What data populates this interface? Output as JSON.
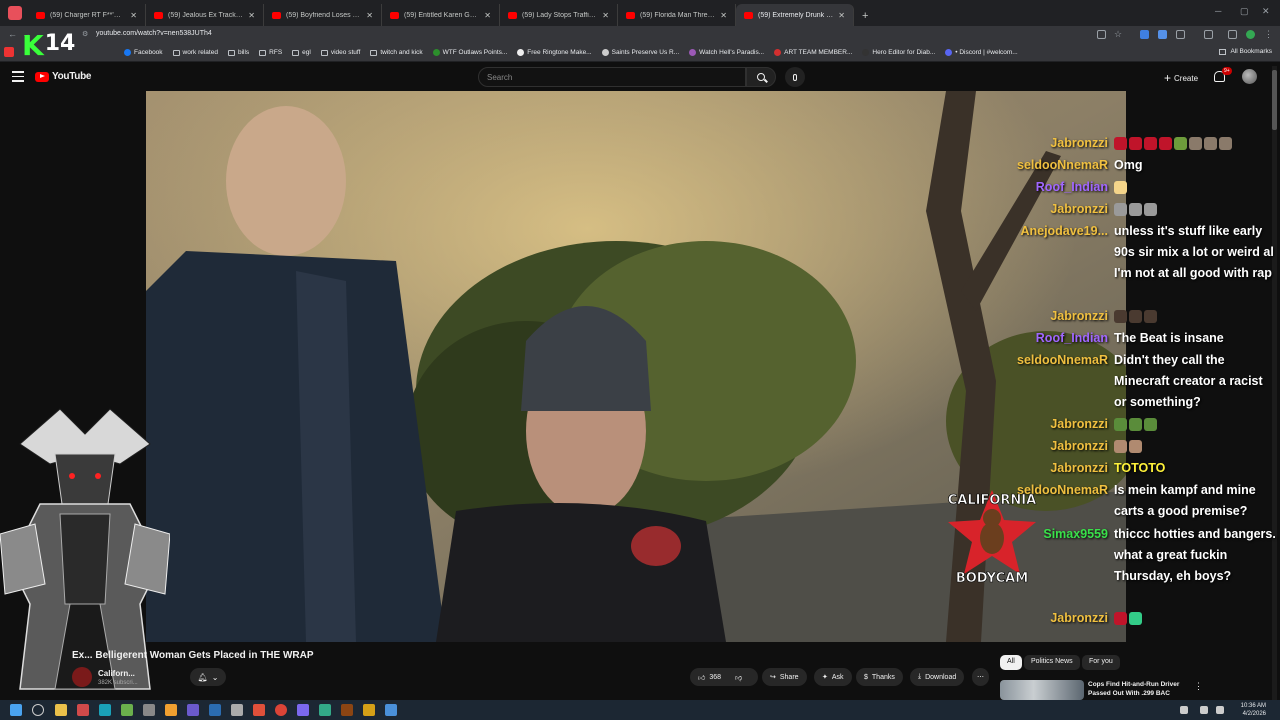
{
  "browser": {
    "tabs": [
      {
        "title": "(59) Charger RT F**'S UP Calif"
      },
      {
        "title": "(59) Jealous Ex Tracks His Loca"
      },
      {
        "title": "(59) Boyfriend Loses It After He"
      },
      {
        "title": "(59) Entitled Karen Goes Ballis"
      },
      {
        "title": "(59) Lady Stops Traffic to Help"
      },
      {
        "title": "(59) Florida Man Threatens Offi"
      },
      {
        "title": "(59) Extremely Drunk and Bellig",
        "active": true
      }
    ],
    "url": "youtube.com/watch?v=nen538JUTh4",
    "bookmarks": [
      "Facebook",
      "work related",
      "bills",
      "RFS",
      "egl",
      "video stuff",
      "twitch and kick",
      "WTF Outlaws Points...",
      "Free Ringtone Make...",
      "Saints Preserve Us R...",
      "Watch Hell's Paradis...",
      "ART TEAM MEMBER...",
      "Hero Editor for Diab...",
      "• Discord | #welcom..."
    ],
    "all_bookmarks": "All Bookmarks",
    "stream_overlay": {
      "k": "K",
      "number": "14"
    }
  },
  "youtube": {
    "logo": "YouTube",
    "search_placeholder": "Search",
    "create_label": "Create",
    "notification_count": "9+"
  },
  "chat": [
    {
      "user": "Jabronzzi",
      "color": "#f0c040",
      "msg": "",
      "emotes": [
        "#c0142a",
        "#c0142a",
        "#c0142a",
        "#c0142a",
        "#6d9c3b",
        "#8a7a6a",
        "#8a7a6a",
        "#8a7a6a"
      ]
    },
    {
      "user": "seldooNnemaR",
      "color": "#f0c040",
      "msg": "Omg",
      "emotes": []
    },
    {
      "user": "Roof_Indian",
      "color": "#a066ff",
      "msg": "",
      "emotes": [
        "#f5d58a"
      ]
    },
    {
      "user": "Jabronzzi",
      "color": "#f0c040",
      "msg": "",
      "emotes": [
        "#9a9a9a",
        "#9a9a9a",
        "#9a9a9a"
      ]
    },
    {
      "user": "Anejodave19...",
      "color": "#f0c040",
      "msg": "unless it's stuff like early 90s sir mix a lot or weird al I'm not at all good with rap",
      "lines": 4,
      "emotes": []
    },
    {
      "user": "Jabronzzi",
      "color": "#f0c040",
      "msg": "",
      "emotes": [
        "#4a3a30",
        "#4a3a30",
        "#4a3a30"
      ]
    },
    {
      "user": "Roof_Indian",
      "color": "#a066ff",
      "msg": "The Beat is insane",
      "emotes": []
    },
    {
      "user": "seldooNnemaR",
      "color": "#f0c040",
      "msg": "Didn't they call the Minecraft creator a racist or something?",
      "lines": 3,
      "emotes": []
    },
    {
      "user": "Jabronzzi",
      "color": "#f0c040",
      "msg": "",
      "emotes": [
        "#5a8c3a",
        "#5a8c3a",
        "#5a8c3a"
      ]
    },
    {
      "user": "Jabronzzi",
      "color": "#f0c040",
      "msg": "",
      "emotes": [
        "#b08a70",
        "#b08a70"
      ]
    },
    {
      "user": "Jabronzzi",
      "color": "#f0c040",
      "msg": "TOTOTO",
      "msg_color": "#fff23a",
      "emotes": []
    },
    {
      "user": "seldooNnemaR",
      "color": "#f0c040",
      "msg": "Is mein kampf and mine carts a good premise?",
      "lines": 2,
      "emotes": []
    },
    {
      "user": "Simax9559",
      "color": "#39e04a",
      "msg": "thiccc hotties and bangers. what a great fuckin Thursday, eh boys?",
      "lines": 3,
      "emotes": []
    },
    {
      "user": "Jabronzzi",
      "color": "#f0c040",
      "msg": "",
      "emotes": [
        "#c0142a",
        "#33cc88"
      ]
    }
  ],
  "logo_overlay": {
    "top": "CALIFORNIA",
    "bottom": "BODYCAM"
  },
  "video": {
    "title": "Ex... Belligerent Woman Gets Placed in THE WRAP",
    "channel": "Californ...",
    "subscribers": "382K subscri...",
    "likes": "368",
    "share": "Share",
    "ask": "Ask",
    "thanks": "Thanks",
    "download": "Download"
  },
  "recommend": {
    "chips": [
      "All",
      "Politics News",
      "For you"
    ],
    "item_title": "Cops Find Hit-and-Run Driver Passed Out With .299 BAC"
  },
  "taskbar": {
    "time": "10:36 AM",
    "date": "4/2/2026"
  }
}
